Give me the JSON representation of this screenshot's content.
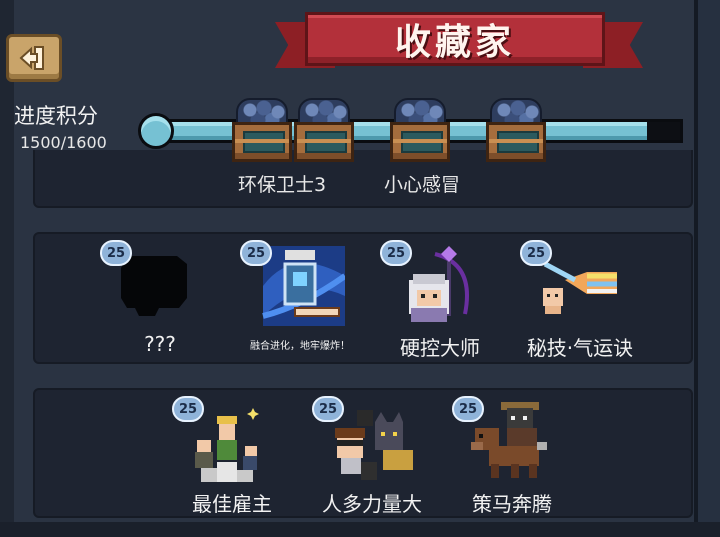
{
  "header": {
    "title": "收藏家",
    "back_icon": "back-arrow-icon"
  },
  "progress": {
    "label": "进度积分",
    "value_text": "1500/1600",
    "current": 1500,
    "max": 1600,
    "milestone_icon": "gem-chest-icon"
  },
  "partial_row": {
    "items": [
      {
        "label": "环保卫士3"
      },
      {
        "label": "小心感冒"
      }
    ]
  },
  "rows": [
    {
      "items": [
        {
          "badge": "25",
          "name": "???",
          "art": "locked-silhouette"
        },
        {
          "badge": "25",
          "caption": "融合进化，地牢爆炸！",
          "art": "blue-card"
        },
        {
          "badge": "25",
          "name": "硬控大师",
          "art": "staff-wizard"
        },
        {
          "badge": "25",
          "name": "秘技·气运诀",
          "art": "rainbow-beam"
        }
      ]
    },
    {
      "items": [
        {
          "badge": "25",
          "name": "最佳雇主",
          "art": "podium-heroes"
        },
        {
          "badge": "25",
          "name": "人多力量大",
          "art": "crowd"
        },
        {
          "badge": "25",
          "name": "策马奔腾",
          "art": "horse-rider"
        }
      ]
    }
  ],
  "colors": {
    "background": "#2a3342",
    "panel": "#1e2431",
    "banner": "#b3303a",
    "progress_fill": "#76c1d3",
    "badge": "#8fb3d9"
  }
}
